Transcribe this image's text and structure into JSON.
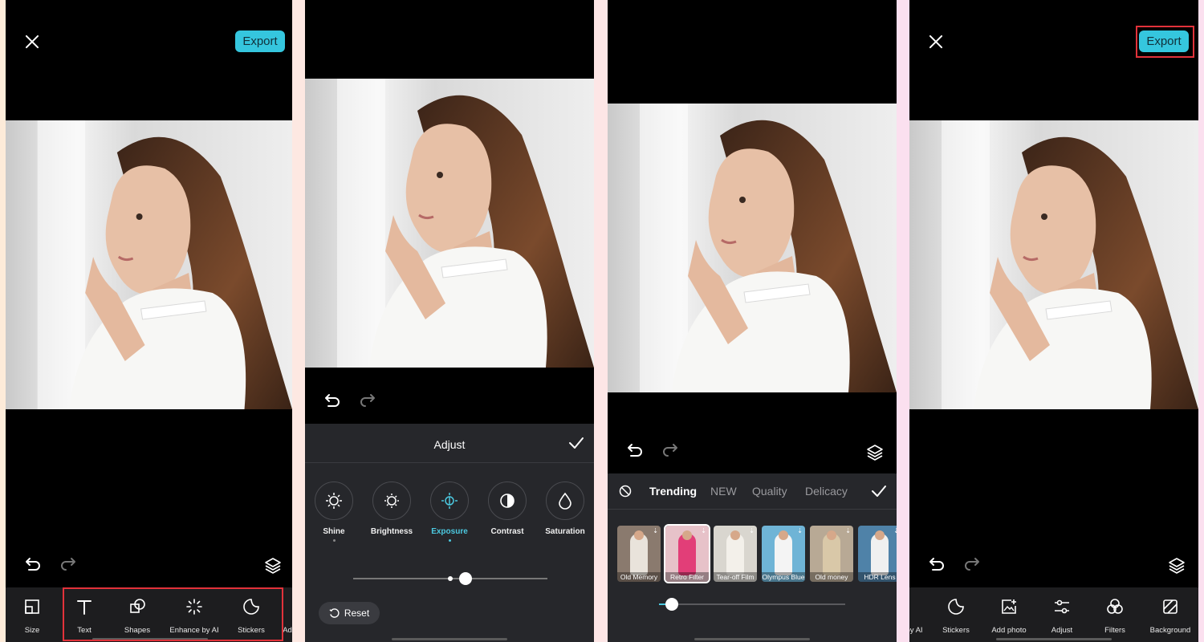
{
  "panel1": {
    "export_label": "Export",
    "tools": [
      {
        "label": "Size",
        "icon": "size-icon"
      },
      {
        "label": "Text",
        "icon": "text-icon"
      },
      {
        "label": "Shapes",
        "icon": "shapes-icon"
      },
      {
        "label": "Enhance by AI",
        "icon": "sparkle-icon"
      },
      {
        "label": "Stickers",
        "icon": "sticker-icon"
      },
      {
        "label": "Ad",
        "icon": ""
      }
    ]
  },
  "panel2": {
    "title": "Adjust",
    "items": [
      {
        "label": "Shine",
        "icon": "shine-icon"
      },
      {
        "label": "Brightness",
        "icon": "brightness-icon"
      },
      {
        "label": "Exposure",
        "icon": "exposure-icon",
        "active": true
      },
      {
        "label": "Contrast",
        "icon": "contrast-icon"
      },
      {
        "label": "Saturation",
        "icon": "saturation-icon"
      }
    ],
    "slider_value": 0.58,
    "reset_label": "Reset"
  },
  "panel3": {
    "tabs": [
      "Trending",
      "NEW",
      "Quality",
      "Delicacy"
    ],
    "active_tab": "Trending",
    "filters": [
      {
        "label": "Old Memory",
        "bg": "#8a7a6e",
        "dress": "#e9e3db"
      },
      {
        "label": "Retro Filter",
        "bg": "#e7c2c9",
        "dress": "#e23e78"
      },
      {
        "label": "Tear-off Film",
        "bg": "#d9d6cf",
        "dress": "#f3f0ea"
      },
      {
        "label": "Olympus Blue",
        "bg": "#6fb4d6",
        "dress": "#f4f4f4"
      },
      {
        "label": "Old money",
        "bg": "#b8a995",
        "dress": "#d9c8a8"
      },
      {
        "label": "HDR Lens",
        "bg": "#4f82a8",
        "dress": "#f0f0f0"
      }
    ],
    "slider_value": 0.07
  },
  "panel4": {
    "export_label": "Export",
    "tools": [
      {
        "label": "by AI",
        "icon": ""
      },
      {
        "label": "Stickers",
        "icon": "sticker-icon"
      },
      {
        "label": "Add photo",
        "icon": "add-photo-icon"
      },
      {
        "label": "Adjust",
        "icon": "adjust-icon"
      },
      {
        "label": "Filters",
        "icon": "filters-icon"
      },
      {
        "label": "Background",
        "icon": "background-icon"
      }
    ]
  },
  "colors": {
    "accent": "#35c6de",
    "highlight": "#e2323a",
    "bg_panel1": "#fdebd9",
    "bg_panel4": "#fbe0ef"
  }
}
